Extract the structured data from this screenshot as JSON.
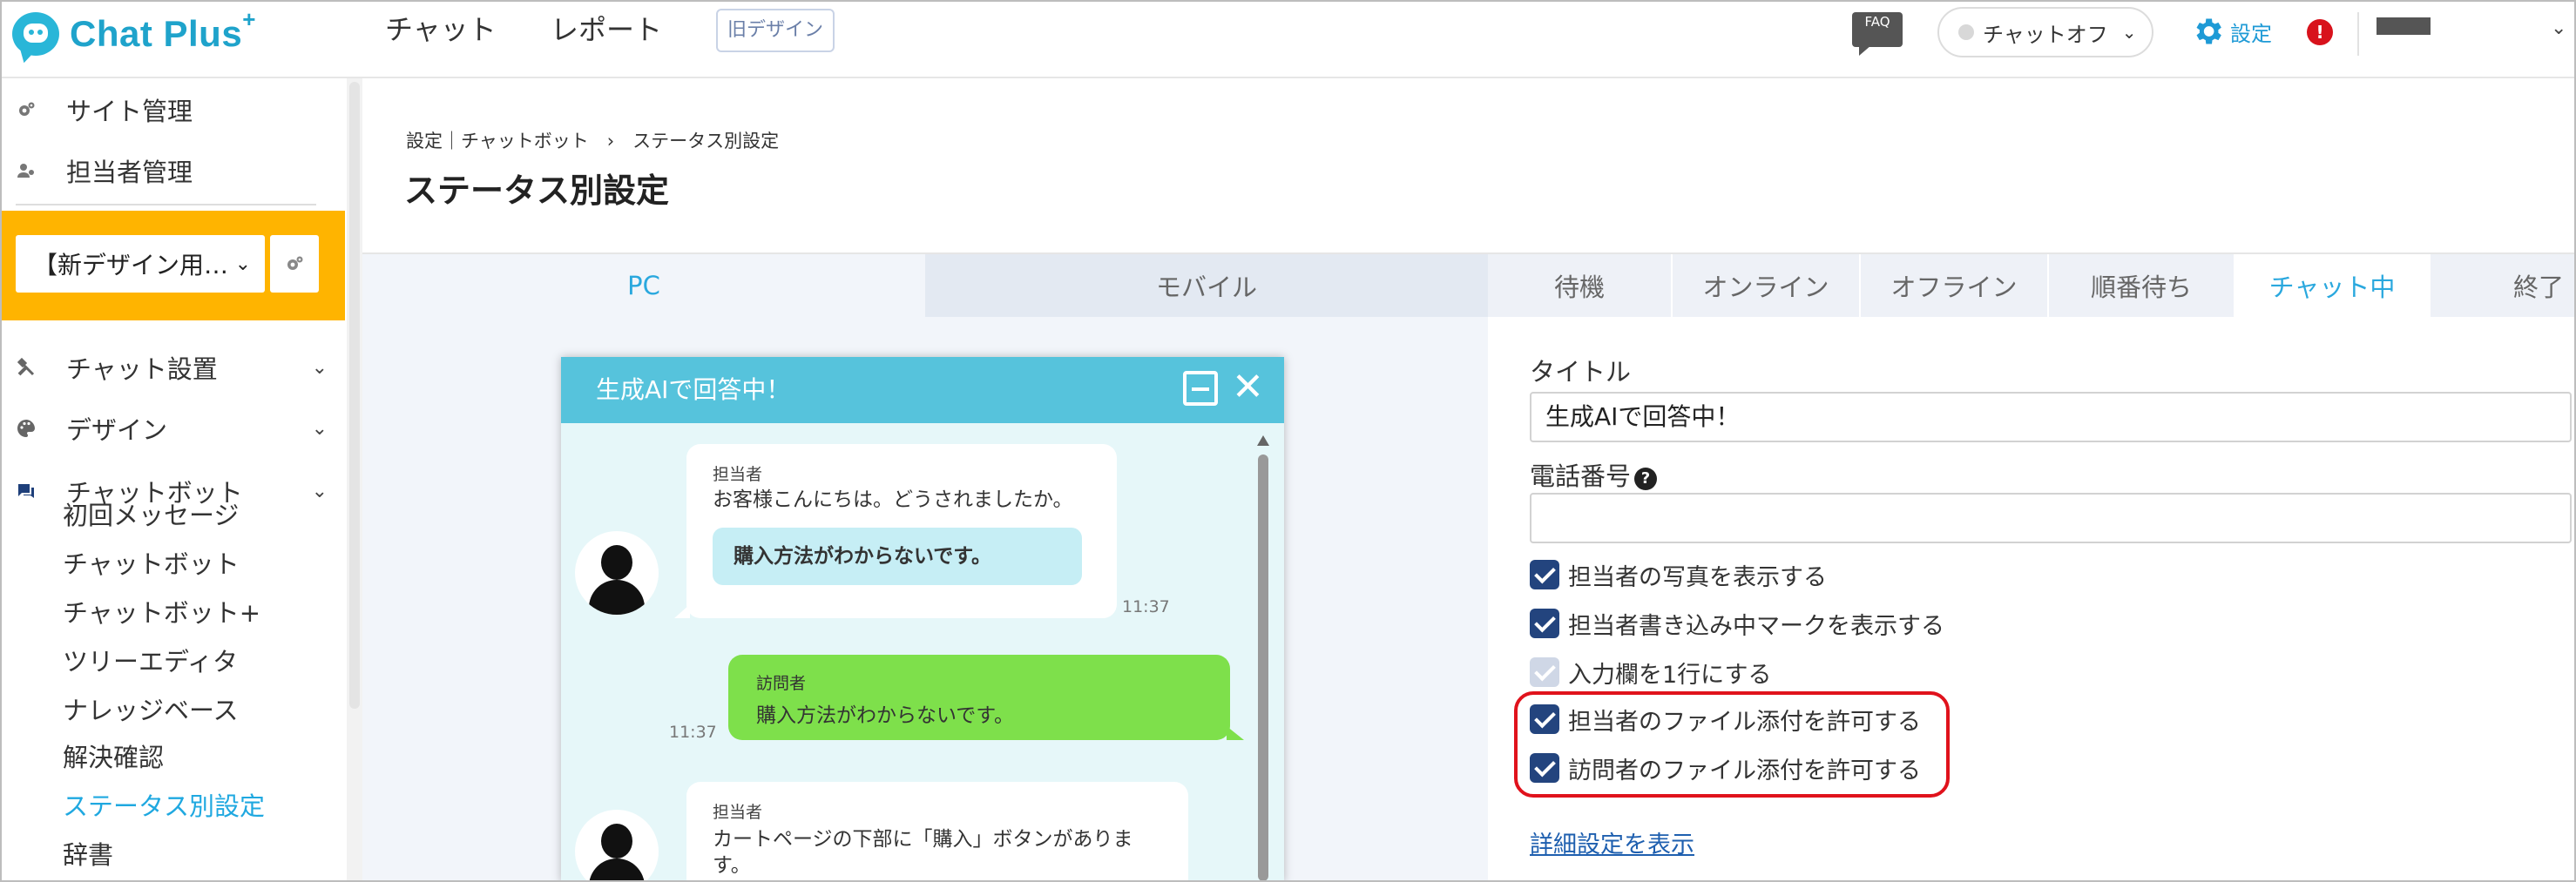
{
  "header": {
    "logo_text": "Chat Plus",
    "logo_plus": "+",
    "nav": [
      "チャット",
      "レポート"
    ],
    "old_design_label": "旧デザイン",
    "faq_label": "FAQ",
    "chat_status": "チャットオフ",
    "settings_label": "設定",
    "alert_label": "!",
    "brand_color": "#1fa3cb"
  },
  "sidebar": {
    "top_items": [
      {
        "label": "サイト管理",
        "icon": "gear-cluster-icon"
      },
      {
        "label": "担当者管理",
        "icon": "users-icon"
      }
    ],
    "site_select_value": "【新デザイン用…",
    "sections": [
      {
        "label": "チャット設置",
        "icon": "tools-icon"
      },
      {
        "label": "デザイン",
        "icon": "palette-icon"
      },
      {
        "label": "チャットボット",
        "icon": "chat-icon"
      }
    ],
    "sub_items": [
      "初回メッセージ",
      "チャットボット",
      "チャットボット+",
      "ツリーエディタ",
      "ナレッジベース",
      "解決確認",
      "ステータス別設定",
      "辞書"
    ],
    "active_sub_item": "ステータス別設定",
    "selector_color": "#ffb400"
  },
  "main": {
    "breadcrumb": "設定｜チャットボット　›　ステータス別設定",
    "page_title": "ステータス別設定",
    "device_tabs": [
      "PC",
      "モバイル"
    ],
    "status_tabs": [
      "待機",
      "オンライン",
      "オフライン",
      "順番待ち",
      "チャット中",
      "終了"
    ],
    "active_status_tab": "チャット中",
    "accent_color": "#2aa8de"
  },
  "preview": {
    "title": "生成AIで回答中！",
    "messages": [
      {
        "sender": "担当者",
        "text": "お客様こんにちは。どうされましたか。",
        "quick_reply": "購入方法がわからないです。",
        "time": "11:37"
      },
      {
        "sender": "訪問者",
        "text": "購入方法がわからないです。",
        "time": "11:37"
      },
      {
        "sender": "担当者",
        "text_line1": "カートページの下部に「購入」ボタンがありま",
        "text_line2": "す。"
      }
    ]
  },
  "form": {
    "title_label": "タイトル",
    "title_value": "生成AIで回答中！",
    "phone_label": "電話番号",
    "phone_value": "",
    "help_icon": "?",
    "checkboxes": [
      {
        "label": "担当者の写真を表示する",
        "checked": true,
        "disabled": false
      },
      {
        "label": "担当者書き込み中マークを表示する",
        "checked": true,
        "disabled": false
      },
      {
        "label": "入力欄を1行にする",
        "checked": true,
        "disabled": true
      },
      {
        "label": "担当者のファイル添付を許可する",
        "checked": true,
        "disabled": false
      },
      {
        "label": "訪問者のファイル添付を許可する",
        "checked": true,
        "disabled": false
      }
    ],
    "details_link": "詳細設定を表示",
    "highlight_color": "#e0121c"
  }
}
